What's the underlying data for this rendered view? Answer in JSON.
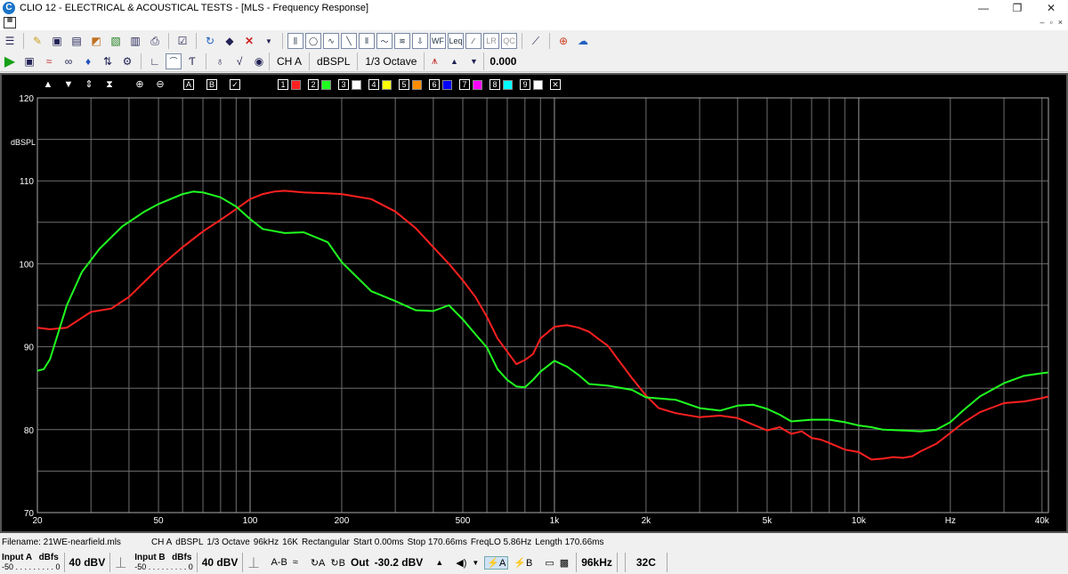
{
  "window": {
    "title": "CLIO 12 - ELECTRICAL & ACOUSTICAL TESTS - [MLS - Frequency Response]",
    "app_icon_letter": "C",
    "controls": [
      "—",
      "❐",
      "✕"
    ],
    "mdi_controls": [
      "–",
      "▫",
      "×"
    ]
  },
  "toolbar2": {
    "channel": "CH A",
    "units": "dBSPL",
    "smoothing": "1/3 Octave",
    "value": "0.000"
  },
  "plot_tools": {
    "marker_a": "A",
    "marker_b": "B",
    "channels": [
      {
        "num": "1",
        "color": "#ff2020"
      },
      {
        "num": "2",
        "color": "#20ff20"
      },
      {
        "num": "3",
        "color": "#ffffff"
      },
      {
        "num": "4",
        "color": "#ffff00"
      },
      {
        "num": "5",
        "color": "#ff8c00"
      },
      {
        "num": "6",
        "color": "#0000ff"
      },
      {
        "num": "7",
        "color": "#ff00ff"
      },
      {
        "num": "8",
        "color": "#00ffff"
      },
      {
        "num": "9",
        "color": "#ffffff"
      }
    ]
  },
  "chart_data": {
    "type": "line",
    "title": "",
    "xlabel": "Hz",
    "ylabel": "dBSPL",
    "x_scale": "log",
    "xlim": [
      20,
      42000
    ],
    "ylim": [
      70,
      120
    ],
    "x_ticks": [
      20,
      50,
      100,
      200,
      500,
      1000,
      2000,
      5000,
      10000,
      40000
    ],
    "x_tick_labels": [
      "20",
      "50",
      "100",
      "200",
      "500",
      "1k",
      "2k",
      "5k",
      "10k",
      "40k"
    ],
    "y_ticks": [
      70,
      80,
      90,
      100,
      110,
      120
    ],
    "grid": true,
    "series": [
      {
        "color": "#ff2020",
        "x": [
          20,
          22,
          25,
          30,
          35,
          40,
          50,
          60,
          70,
          80,
          90,
          100,
          110,
          120,
          130,
          150,
          180,
          200,
          250,
          300,
          350,
          400,
          450,
          500,
          550,
          600,
          650,
          700,
          750,
          800,
          850,
          900,
          1000,
          1100,
          1200,
          1300,
          1400,
          1500,
          1600,
          1800,
          2000,
          2200,
          2500,
          3000,
          3500,
          4000,
          4500,
          5000,
          5500,
          6000,
          6500,
          7000,
          7500,
          8000,
          9000,
          10000,
          11000,
          12000,
          13000,
          14000,
          15000,
          16000,
          18000,
          20000,
          22000,
          25000,
          30000,
          35000,
          40000,
          42000
        ],
        "y": [
          92.3,
          92.1,
          92.3,
          94.2,
          94.6,
          96.0,
          99.5,
          102.0,
          103.9,
          105.3,
          106.6,
          107.8,
          108.4,
          108.7,
          108.8,
          108.6,
          108.5,
          108.4,
          107.8,
          106.3,
          104.3,
          102.0,
          100.0,
          98.0,
          96.0,
          93.6,
          91.0,
          89.4,
          87.9,
          88.4,
          89.1,
          91.0,
          92.4,
          92.6,
          92.3,
          91.8,
          90.9,
          90.1,
          88.7,
          86.2,
          84.1,
          82.6,
          82.0,
          81.5,
          81.7,
          81.4,
          80.6,
          79.9,
          80.3,
          79.5,
          79.8,
          79.0,
          78.8,
          78.4,
          77.6,
          77.3,
          76.4,
          76.5,
          76.7,
          76.6,
          76.8,
          77.4,
          78.3,
          79.6,
          80.8,
          82.1,
          83.2,
          83.4,
          83.8,
          84.0
        ]
      },
      {
        "color": "#20ff20",
        "x": [
          20,
          21,
          22,
          25,
          28,
          32,
          38,
          45,
          50,
          60,
          65,
          70,
          80,
          90,
          100,
          110,
          130,
          150,
          180,
          200,
          250,
          300,
          350,
          400,
          450,
          500,
          550,
          600,
          650,
          700,
          750,
          800,
          850,
          900,
          1000,
          1100,
          1200,
          1300,
          1500,
          1800,
          2000,
          2500,
          3000,
          3500,
          4000,
          4500,
          5000,
          5500,
          6000,
          7000,
          8000,
          9000,
          10000,
          11000,
          12000,
          14000,
          16000,
          18000,
          20000,
          22000,
          25000,
          30000,
          35000,
          40000,
          42000
        ],
        "y": [
          87.1,
          87.3,
          88.5,
          95.0,
          99.0,
          101.8,
          104.5,
          106.3,
          107.2,
          108.4,
          108.7,
          108.6,
          108.0,
          106.9,
          105.4,
          104.2,
          103.7,
          103.8,
          102.6,
          100.2,
          96.7,
          95.5,
          94.4,
          94.3,
          95.0,
          93.3,
          91.5,
          89.9,
          87.3,
          86.0,
          85.2,
          85.1,
          86.0,
          87.0,
          88.3,
          87.6,
          86.6,
          85.5,
          85.3,
          84.8,
          83.9,
          83.6,
          82.6,
          82.3,
          82.9,
          83.0,
          82.5,
          81.8,
          81.0,
          81.2,
          81.2,
          80.9,
          80.5,
          80.3,
          80.0,
          79.9,
          79.8,
          80.0,
          80.9,
          82.3,
          84.0,
          85.6,
          86.5,
          86.8,
          86.9
        ]
      }
    ]
  },
  "infobar": {
    "filename": "Filename: 21WE-nearfield.mls",
    "channel": "CH A",
    "units": "dBSPL",
    "smoothing": "1/3 Octave",
    "rate": "96kHz",
    "size": "16K",
    "window": "Rectangular",
    "start": "Start 0.00ms",
    "stop": "Stop 170.66ms",
    "freqlo": "FreqLO 5.86Hz",
    "length": "Length 170.66ms"
  },
  "statusbar": {
    "input_a_label": "Input A",
    "input_a_scale_label": "dBfs",
    "input_a_scale": "-50 . . . . . . . . . 0",
    "input_a_range": "40 dBV",
    "input_b_label": "Input B",
    "input_b_scale_label": "dBfs",
    "input_b_scale": "-50 . . . . . . . . . 0",
    "input_b_range": "40 dBV",
    "ab": "A-B",
    "out_label": "Out",
    "out_value": "-30.2 dBV",
    "rate": "96kHz",
    "temp": "32C"
  }
}
